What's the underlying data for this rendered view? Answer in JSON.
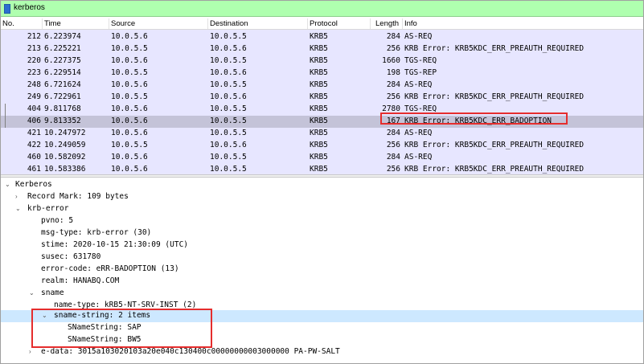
{
  "filter": {
    "value": "kerberos"
  },
  "columns": [
    "No.",
    "Time",
    "Source",
    "Destination",
    "Protocol",
    "Length",
    "Info"
  ],
  "packets": [
    {
      "no": "212",
      "time": "6.223974",
      "src": "10.0.5.6",
      "dst": "10.0.5.5",
      "proto": "KRB5",
      "len": "284",
      "info": "AS-REQ"
    },
    {
      "no": "213",
      "time": "6.225221",
      "src": "10.0.5.5",
      "dst": "10.0.5.6",
      "proto": "KRB5",
      "len": "256",
      "info": "KRB Error: KRB5KDC_ERR_PREAUTH_REQUIRED"
    },
    {
      "no": "220",
      "time": "6.227375",
      "src": "10.0.5.6",
      "dst": "10.0.5.5",
      "proto": "KRB5",
      "len": "1660",
      "info": "TGS-REQ"
    },
    {
      "no": "223",
      "time": "6.229514",
      "src": "10.0.5.5",
      "dst": "10.0.5.6",
      "proto": "KRB5",
      "len": "198",
      "info": "TGS-REP"
    },
    {
      "no": "248",
      "time": "6.721624",
      "src": "10.0.5.6",
      "dst": "10.0.5.5",
      "proto": "KRB5",
      "len": "284",
      "info": "AS-REQ"
    },
    {
      "no": "249",
      "time": "6.722961",
      "src": "10.0.5.5",
      "dst": "10.0.5.6",
      "proto": "KRB5",
      "len": "256",
      "info": "KRB Error: KRB5KDC_ERR_PREAUTH_REQUIRED"
    },
    {
      "no": "404",
      "time": "9.811768",
      "src": "10.0.5.6",
      "dst": "10.0.5.5",
      "proto": "KRB5",
      "len": "2780",
      "info": "TGS-REQ"
    },
    {
      "no": "406",
      "time": "9.813352",
      "src": "10.0.5.6",
      "dst": "10.0.5.5",
      "proto": "KRB5",
      "len": "167",
      "info": "KRB Error: KRB5KDC_ERR_BADOPTION"
    },
    {
      "no": "421",
      "time": "10.247972",
      "src": "10.0.5.6",
      "dst": "10.0.5.5",
      "proto": "KRB5",
      "len": "284",
      "info": "AS-REQ"
    },
    {
      "no": "422",
      "time": "10.249059",
      "src": "10.0.5.5",
      "dst": "10.0.5.6",
      "proto": "KRB5",
      "len": "256",
      "info": "KRB Error: KRB5KDC_ERR_PREAUTH_REQUIRED"
    },
    {
      "no": "460",
      "time": "10.582092",
      "src": "10.0.5.6",
      "dst": "10.0.5.5",
      "proto": "KRB5",
      "len": "284",
      "info": "AS-REQ"
    },
    {
      "no": "461",
      "time": "10.583386",
      "src": "10.0.5.6",
      "dst": "10.0.5.5",
      "proto": "KRB5",
      "len": "256",
      "info": "KRB Error: KRB5KDC_ERR_PREAUTH_REQUIRED"
    }
  ],
  "details": {
    "kerberos": "Kerberos",
    "record_mark": "Record Mark: 109 bytes",
    "krb_error": "krb-error",
    "pvno": "pvno: 5",
    "msg_type": "msg-type: krb-error (30)",
    "stime": "stime: 2020-10-15 21:30:09 (UTC)",
    "susec": "susec: 631780",
    "error_code": "error-code: eRR-BADOPTION (13)",
    "realm": "realm: HANABQ.COM",
    "sname": "sname",
    "name_type": "name-type: kRB5-NT-SRV-INST (2)",
    "sname_string": "sname-string: 2 items",
    "sname_sap": "SNameString: SAP",
    "sname_bw5": "SNameString: BW5",
    "e_data": "e-data: 3015a103020103a20e040c130400c00000000003000000 PA-PW-SALT"
  },
  "colors": {
    "filter_bg": "#afffaf",
    "row_bg": "#e7e6ff",
    "selected_row_bg": "#c4c3d8",
    "selected_detail_bg": "#cde8ff",
    "highlight_border": "#e52d2d"
  }
}
